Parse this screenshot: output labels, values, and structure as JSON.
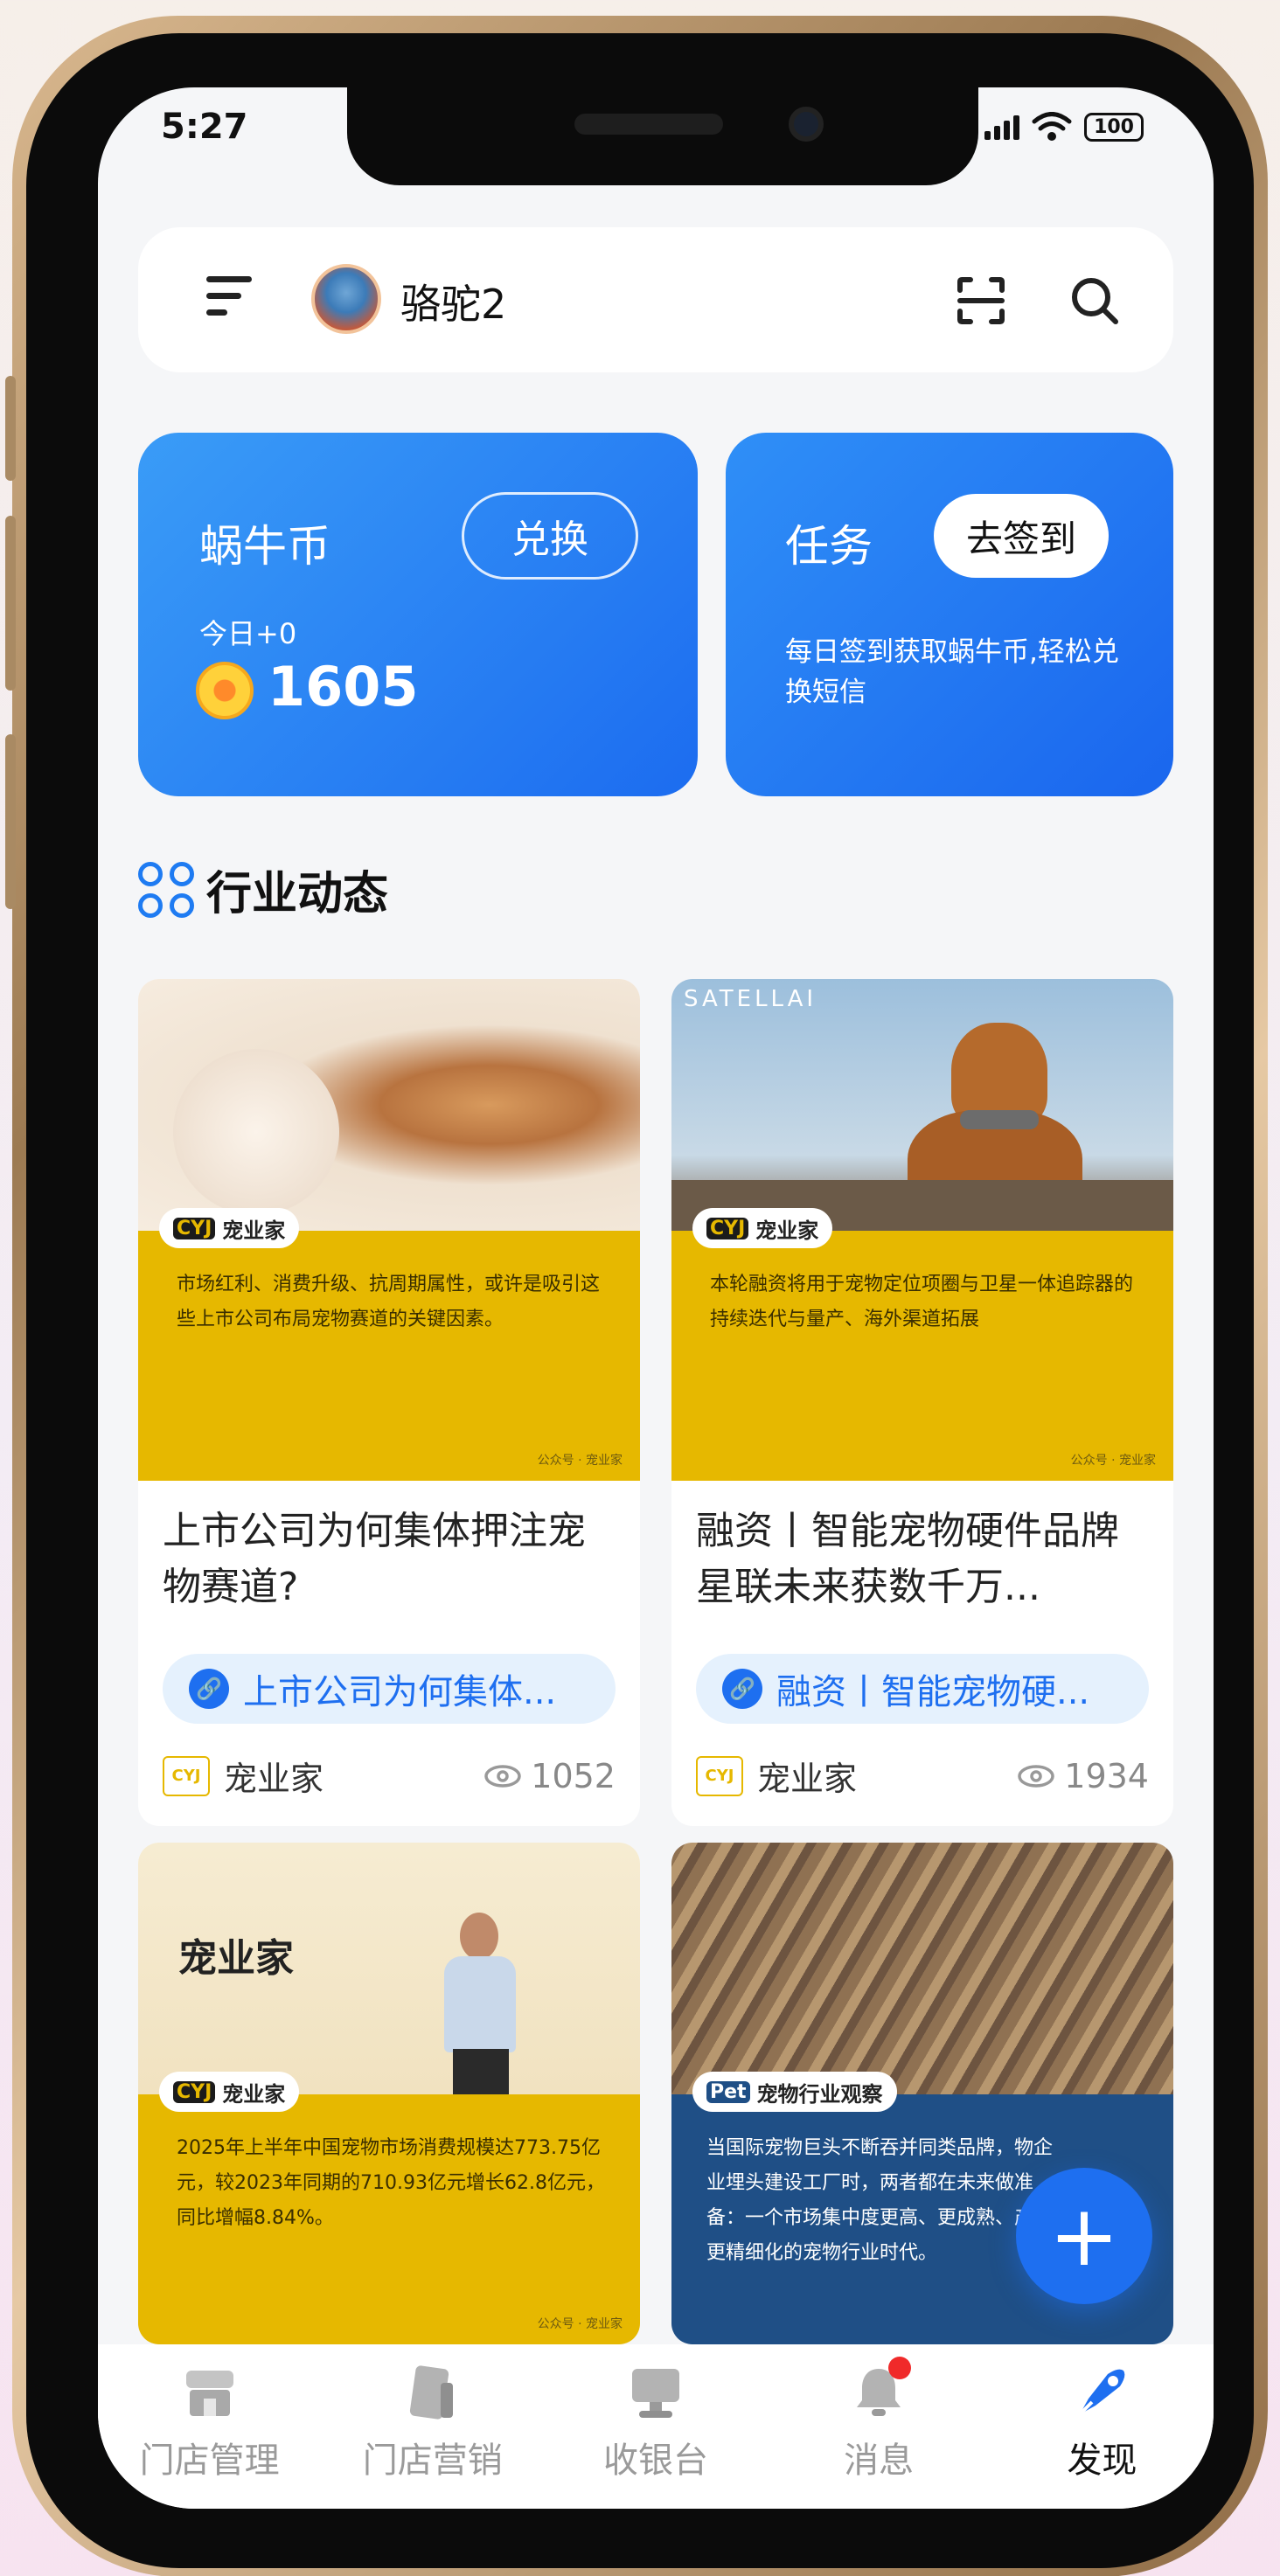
{
  "status_bar": {
    "time": "5:27",
    "battery": "100"
  },
  "header": {
    "username": "骆驼2"
  },
  "coin_card": {
    "title": "蜗牛币",
    "exchange_label": "兑换",
    "today": "今日+0",
    "balance": "1605"
  },
  "task_card": {
    "title": "任务",
    "checkin_label": "去签到",
    "description": "每日签到获取蜗牛币,轻松兑换短信"
  },
  "section": {
    "title": "行业动态"
  },
  "articles": [
    {
      "brand_tag": "宠业家",
      "thumb_text": "市场红利、消费升级、抗周期属性，或许是吸引这些上市公司布局宠物赛道的关键因素。",
      "thumb_footer": "公众号 · 宠业家",
      "title": "上市公司为何集体押注宠物赛道?",
      "link_text": "上市公司为何集体...",
      "source": "宠业家",
      "views": "1052"
    },
    {
      "photo_label": "SATELLAI",
      "brand_tag": "宠业家",
      "thumb_text": "本轮融资将用于宠物定位项圈与卫星一体追踪器的持续迭代与量产、海外渠道拓展",
      "thumb_footer": "公众号 · 宠业家",
      "title": "融资丨智能宠物硬件品牌星联未来获数千万...",
      "link_text": "融资丨智能宠物硬...",
      "source": "宠业家",
      "views": "1934"
    },
    {
      "photo_label": "宠业家",
      "brand_tag": "宠业家",
      "thumb_text": "2025年上半年中国宠物市场消费规模达773.75亿元，较2023年同期的710.93亿元增长62.8亿元，同比增幅8.84%。",
      "thumb_footer": "公众号 · 宠业家"
    },
    {
      "brand_tag": "宠物行业观察",
      "thumb_text": "当国际宠物巨头不断吞并同类品牌，物企业埋头建设工厂时，两者都在未来做准备：一个市场集中度更高、更成熟、产品更精细化的宠物行业时代。"
    }
  ],
  "bottom_nav": [
    {
      "label": "门店管理"
    },
    {
      "label": "门店营销"
    },
    {
      "label": "收银台"
    },
    {
      "label": "消息"
    },
    {
      "label": "发现"
    }
  ],
  "colors": {
    "primary": "#1e6ff0",
    "brand_yellow": "#e6b800",
    "badge_red": "#f02a2a"
  },
  "icons": [
    "menu-icon",
    "scan-icon",
    "search-icon",
    "grid-icon",
    "link-icon",
    "eye-icon",
    "plus-icon",
    "store-icon",
    "marketing-icon",
    "cashier-icon",
    "bell-icon",
    "discover-icon"
  ]
}
